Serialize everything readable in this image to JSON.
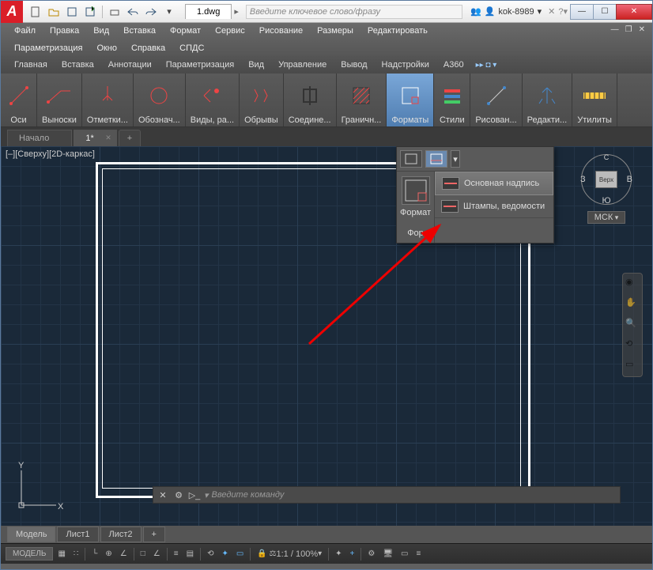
{
  "title": "1.dwg",
  "search_placeholder": "Введите ключевое слово/фразу",
  "user": "kok-8989",
  "menu": [
    "Файл",
    "Правка",
    "Вид",
    "Вставка",
    "Формат",
    "Сервис",
    "Рисование",
    "Размеры",
    "Редактировать",
    "Параметризация",
    "Окно",
    "Справка",
    "СПДС"
  ],
  "ribbon_tabs": [
    "Главная",
    "Вставка",
    "Аннотации",
    "Параметризация",
    "Вид",
    "Управление",
    "Вывод",
    "Надстройки",
    "A360"
  ],
  "panels": [
    "Оси",
    "Выноски",
    "Отметки...",
    "Обознач...",
    "Виды, ра...",
    "Обрывы",
    "Соедине...",
    "Граничн...",
    "Форматы",
    "Стили",
    "Рисован...",
    "Редакти...",
    "Утилиты"
  ],
  "file_tabs": {
    "start": "Начало",
    "active": "1*"
  },
  "viewport": "[–][Сверху][2D-каркас]",
  "dropdown": {
    "left_label": "Формат",
    "left_label2": "Фор",
    "items": [
      "Основная надпись",
      "Штампы, ведомости"
    ]
  },
  "viewcube": {
    "top": "С",
    "bottom": "Ю",
    "left": "З",
    "right": "В",
    "face": "Верх",
    "cs": "МСК"
  },
  "ucs": {
    "x": "X",
    "y": "Y"
  },
  "layout_tabs": [
    "Модель",
    "Лист1",
    "Лист2"
  ],
  "cmd_placeholder": "Введите команду",
  "status": {
    "model": "МОДЕЛЬ",
    "scale": "1:1 / 100%"
  }
}
